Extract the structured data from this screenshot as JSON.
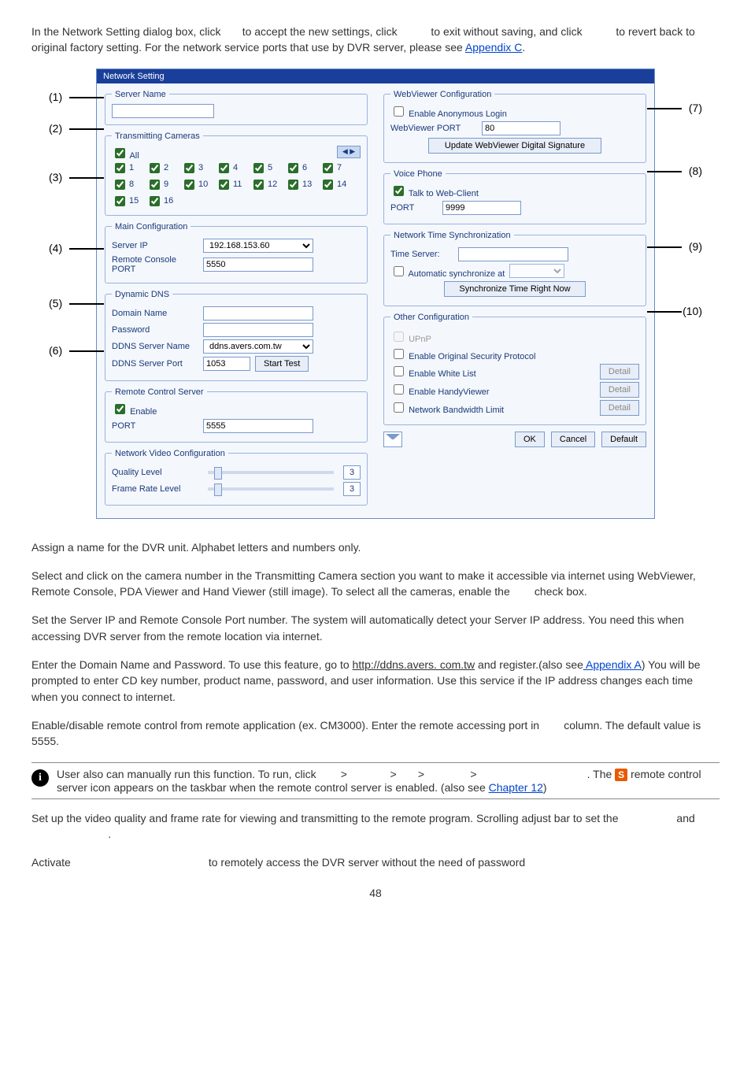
{
  "intro": {
    "text_a": "In the Network Setting dialog box, click",
    "text_b": "to accept the new settings, click",
    "text_c": "to exit without saving, and click",
    "text_d": "to revert back to original factory setting. For the network service ports that use by DVR server, please see ",
    "appendix_c": "Appendix C",
    "period": "."
  },
  "dialog": {
    "title": "Network Setting",
    "serverName": {
      "legend": "Server Name"
    },
    "transmitting": {
      "legend": "Transmitting Cameras",
      "allLabel": "All",
      "cams": [
        "1",
        "2",
        "3",
        "4",
        "5",
        "6",
        "7",
        "8",
        "9",
        "10",
        "11",
        "12",
        "13",
        "14",
        "15",
        "16"
      ]
    },
    "mainConfig": {
      "legend": "Main Configuration",
      "serverIpLabel": "Server IP",
      "serverIpValue": "192.168.153.60",
      "remotePortLabel": "Remote Console PORT",
      "remotePortValue": "5550"
    },
    "ddns": {
      "legend": "Dynamic DNS",
      "domainLabel": "Domain Name",
      "passwordLabel": "Password",
      "serverNameLabel": "DDNS Server Name",
      "serverNameValue": "ddns.avers.com.tw",
      "serverPortLabel": "DDNS Server Port",
      "serverPortValue": "1053",
      "startTest": "Start Test"
    },
    "rcs": {
      "legend": "Remote Control Server",
      "enable": "Enable",
      "portLabel": "PORT",
      "portValue": "5555"
    },
    "nvc": {
      "legend": "Network Video Configuration",
      "quality": "Quality Level",
      "frame": "Frame Rate Level",
      "val": "3"
    },
    "webviewer": {
      "legend": "WebViewer Configuration",
      "anon": "Enable Anonymous Login",
      "portLabel": "WebViewer PORT",
      "portValue": "80",
      "updateBtn": "Update WebViewer Digital Signature"
    },
    "voice": {
      "legend": "Voice Phone",
      "talk": "Talk to Web-Client",
      "portLabel": "PORT",
      "portValue": "9999"
    },
    "nts": {
      "legend": "Network Time Synchronization",
      "tsLabel": "Time Server:",
      "auto": "Automatic synchronize at",
      "syncBtn": "Synchronize Time Right Now"
    },
    "other": {
      "legend": "Other Configuration",
      "upnp": "UPnP",
      "origsec": "Enable Original Security Protocol",
      "whitelist": "Enable White List",
      "handy": "Enable HandyViewer",
      "bw": "Network Bandwidth Limit",
      "detail": "Detail"
    },
    "footer": {
      "ok": "OK",
      "cancel": "Cancel",
      "default": "Default"
    }
  },
  "callouts": {
    "l1": "(1)",
    "l2": "(2)",
    "l3": "(3)",
    "l4": "(4)",
    "l5": "(5)",
    "l6": "(6)",
    "r7": "(7)",
    "r8": "(8)",
    "r9": "(9)",
    "r10": "(10)"
  },
  "paras": {
    "p1": "Assign a name for the DVR unit. Alphabet letters and numbers only.",
    "p2": "Select and click on the camera number in the Transmitting Camera section you want to make it accessible via internet using WebViewer, Remote Console, PDA Viewer and Hand Viewer (still image). To select all the cameras, enable the",
    "p2b": "check box.",
    "p3": "Set the Server IP and Remote Console Port number. The system will automatically detect your Server IP address. You need this when accessing DVR server from the remote location via internet.",
    "p4a": "Enter the Domain Name and Password. To use this feature, go to ",
    "p4link1": "http://ddns.avers. com.tw",
    "p4b": " and register.(also see",
    "p4link2": " Appendix A",
    "p4c": ") You will be prompted to enter CD key number, product name, password, and user information. Use this service if the IP address changes each time when you connect to internet.",
    "p5a": "Enable/disable remote control from remote application (ex. CM3000). Enter the remote accessing port in",
    "p5b": "column. The default value is 5555.",
    "info_a": "User also can manually run this function. To run, click",
    "gt": ">",
    "info_b": ". The ",
    "info_c": " remote control server icon appears on the taskbar when the remote control server is enabled. (also see ",
    "info_link": "Chapter 12",
    "info_d": ")",
    "p6a": "Set up the video quality and frame rate for viewing and transmitting to the remote program. Scrolling adjust bar to set the",
    "p6b": "and",
    "p6c": ".",
    "p7a": "Activate",
    "p7b": "to remotely access the DVR server without the need of password"
  },
  "pagenum": "48"
}
